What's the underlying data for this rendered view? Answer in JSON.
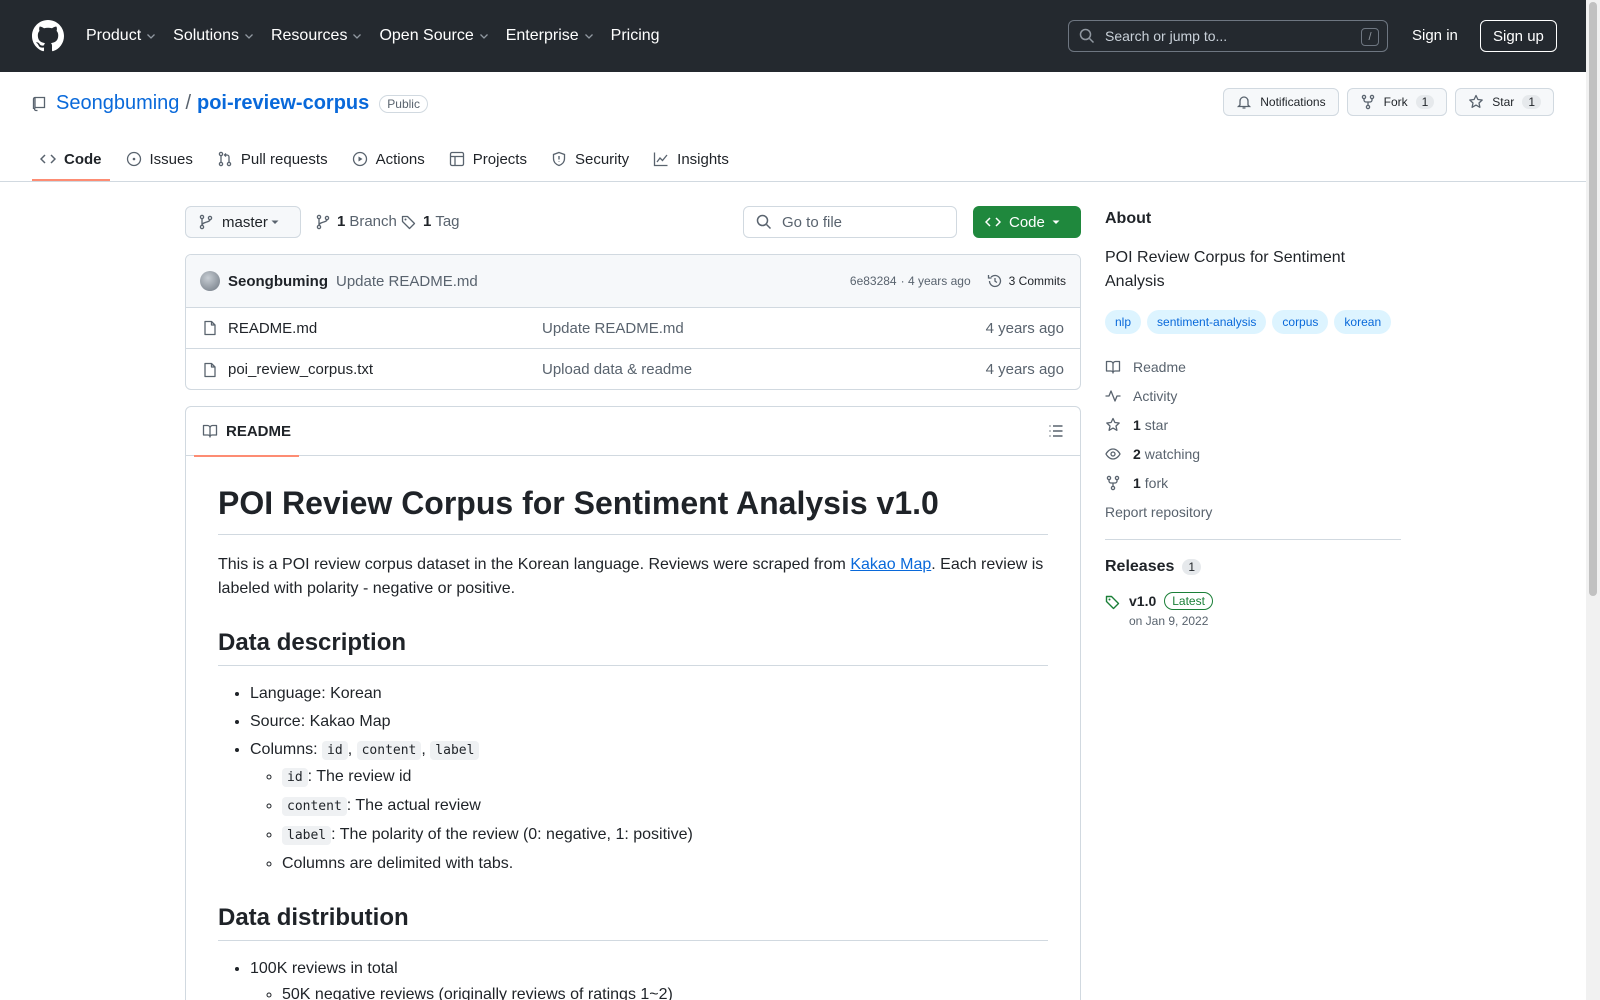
{
  "header": {
    "nav": [
      "Product",
      "Solutions",
      "Resources",
      "Open Source",
      "Enterprise",
      "Pricing"
    ],
    "search_placeholder": "Search or jump to...",
    "search_shortcut": "/",
    "sign_in": "Sign in",
    "sign_up": "Sign up"
  },
  "repo": {
    "owner": "Seongbuming",
    "separator": "/",
    "name": "poi-review-corpus",
    "visibility": "Public",
    "notifications_label": "Notifications",
    "fork_label": "Fork",
    "fork_count": "1",
    "star_label": "Star",
    "star_count": "1"
  },
  "tabs": [
    "Code",
    "Issues",
    "Pull requests",
    "Actions",
    "Projects",
    "Security",
    "Insights"
  ],
  "branch": {
    "name": "master",
    "branch_count": "1",
    "branch_label": "Branch",
    "tag_count": "1",
    "tag_label": "Tag",
    "goto_placeholder": "Go to file",
    "code_label": "Code"
  },
  "commit": {
    "author": "Seongbuming",
    "message": "Update README.md",
    "hash": "6e83284",
    "time": "· 4 years ago",
    "commits_label": "3 Commits"
  },
  "files": [
    {
      "name": "README.md",
      "message": "Update README.md",
      "date": "4 years ago"
    },
    {
      "name": "poi_review_corpus.txt",
      "message": "Upload data & readme",
      "date": "4 years ago"
    }
  ],
  "readme": {
    "tab_label": "README",
    "title": "POI Review Corpus for Sentiment Analysis v1.0",
    "intro_before": "This is a POI review corpus dataset in the Korean language. Reviews were scraped from ",
    "intro_link": "Kakao Map",
    "intro_after": ". Each review is labeled with polarity - negative or positive.",
    "h2_description": "Data description",
    "language": "Language: Korean",
    "source": "Source: Kakao Map",
    "columns_label": "Columns: ",
    "col_id": "id",
    "col_content": "content",
    "col_label": "label",
    "comma": ",",
    "id_desc": ": The review id",
    "content_desc": ": The actual review",
    "label_desc": ": The polarity of the review (0: negative, 1: positive)",
    "delimited": "Columns are delimited with tabs.",
    "h2_distribution": "Data distribution",
    "total": "100K reviews in total",
    "negative": "50K negative reviews (originally reviews of ratings 1~2)"
  },
  "about": {
    "title": "About",
    "description": "POI Review Corpus for Sentiment Analysis",
    "topics": [
      "nlp",
      "sentiment-analysis",
      "corpus",
      "korean"
    ],
    "readme": "Readme",
    "activity": "Activity",
    "stars_count": "1",
    "stars_label": "star",
    "watching_count": "2",
    "watching_label": "watching",
    "forks_count": "1",
    "forks_label": "fork",
    "report": "Report repository"
  },
  "releases": {
    "title": "Releases",
    "count": "1",
    "tag": "v1.0",
    "latest": "Latest",
    "date": "on Jan 9, 2022"
  },
  "colors": {
    "header_bg": "#24292f",
    "link": "#0969da",
    "green": "#1f883d",
    "tab_underline": "#fd8c73"
  }
}
